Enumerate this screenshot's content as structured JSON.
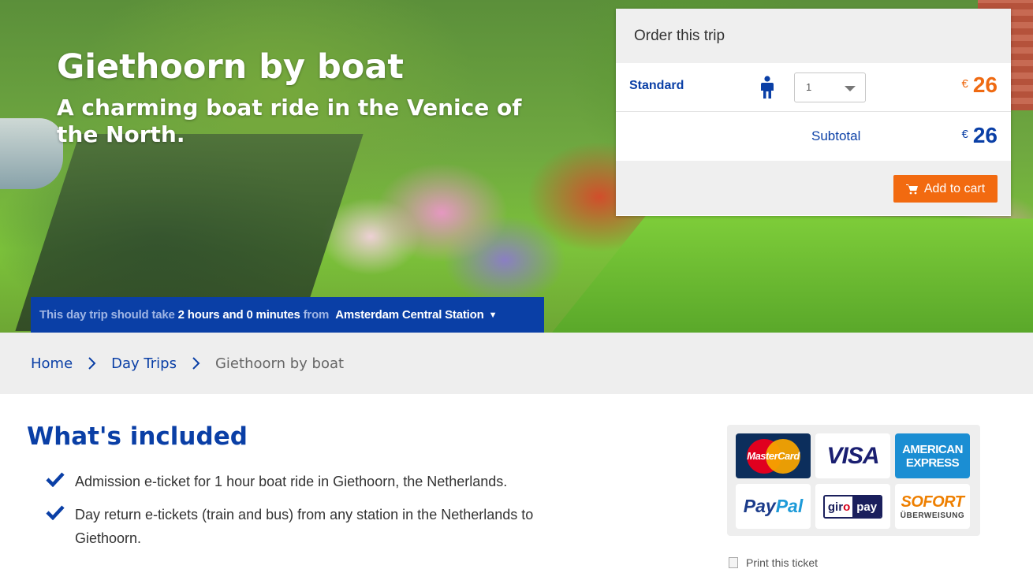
{
  "hero": {
    "title": "Giethoorn by boat",
    "subtitle": "A charming boat ride in the Venice of the North."
  },
  "duration": {
    "prefix": "This day trip should take",
    "time": "2 hours and 0 minutes",
    "from": "from",
    "station": "Amsterdam Central Station",
    "station_caret": "▼"
  },
  "order": {
    "title": "Order this trip",
    "ticket_type": "Standard",
    "quantity": "1",
    "currency": "€",
    "price": "26",
    "subtotal_label": "Subtotal",
    "subtotal_currency": "€",
    "subtotal": "26",
    "add_to_cart": "Add to cart",
    "colors": {
      "accent": "#f26a10",
      "primary": "#0a3fa6"
    }
  },
  "breadcrumb": {
    "items": [
      "Home",
      "Day Trips",
      "Giethoorn by boat"
    ]
  },
  "included": {
    "title": "What's included",
    "items": [
      "Admission e-ticket for 1 hour boat ride in Giethoorn, the Netherlands.",
      "Day return e-tickets (train and bus) from any station in the Netherlands to Giethoorn."
    ]
  },
  "payment": {
    "mastercard": "MasterCard",
    "visa": "VISA",
    "amex_line1": "AMERICAN",
    "amex_line2": "EXPRESS",
    "paypal_1": "Pay",
    "paypal_2": "Pal",
    "giropay_1a": "gir",
    "giropay_1b": "o",
    "giropay_2": "pay",
    "sofort_1": "SOFORT",
    "sofort_2": "ÜBERWEISUNG"
  },
  "print": {
    "label": "Print this ticket"
  }
}
